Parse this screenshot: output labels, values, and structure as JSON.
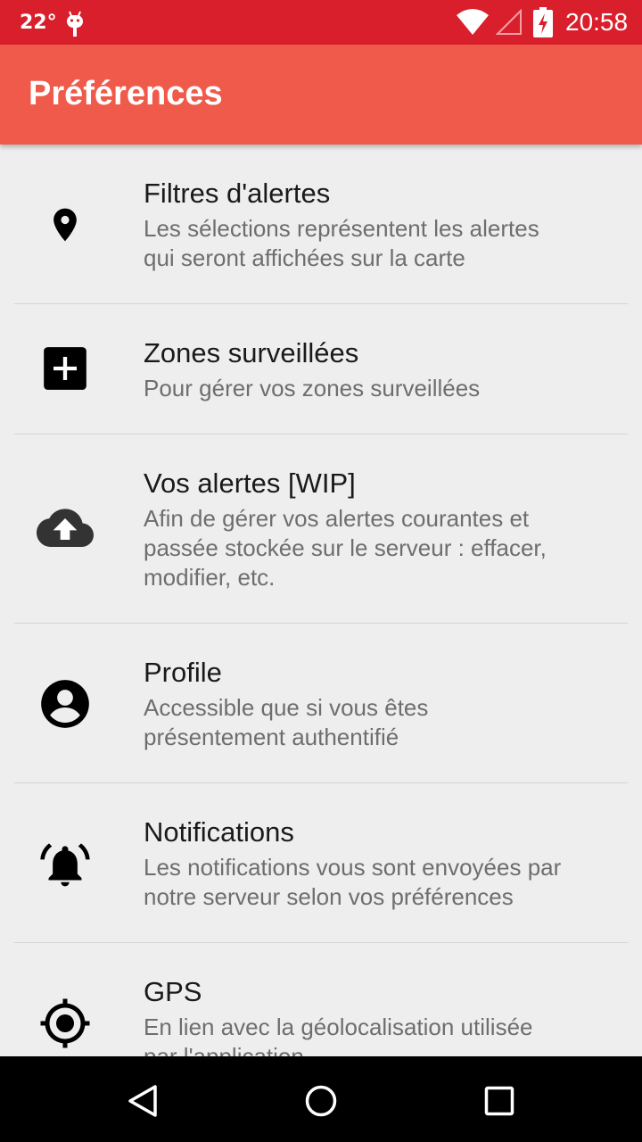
{
  "status_bar": {
    "temperature": "22°",
    "time": "20:58",
    "icons": [
      "android-debug-icon",
      "wifi-icon",
      "signal-icon",
      "battery-charging-icon"
    ]
  },
  "app_bar": {
    "title": "Préférences",
    "color": "#ef5a4a",
    "status_color": "#d81f2b"
  },
  "preferences": [
    {
      "icon": "location-pin-icon",
      "title": "Filtres d'alertes",
      "summary_lines": [
        "Les sélections représentent les alertes",
        "qui seront affichées sur la carte"
      ]
    },
    {
      "icon": "add-box-icon",
      "title": "Zones surveillées",
      "summary_lines": [
        "Pour gérer vos zones surveillées"
      ]
    },
    {
      "icon": "cloud-upload-icon",
      "title": "Vos alertes [WIP]",
      "summary_lines": [
        "Afin de gérer vos alertes courantes et",
        "passée stockée sur le serveur : effacer,",
        "modifier, etc."
      ]
    },
    {
      "icon": "account-circle-icon",
      "title": "Profile",
      "summary_lines": [
        "Accessible que si vous êtes",
        "présentement authentifié"
      ]
    },
    {
      "icon": "notification-bell-icon",
      "title": "Notifications",
      "summary_lines": [
        "Les notifications vous sont envoyées par",
        "notre serveur selon vos préférences"
      ]
    },
    {
      "icon": "gps-fixed-icon",
      "title": "GPS",
      "summary_lines": [
        "En lien avec la géolocalisation utilisée",
        "par l'application"
      ]
    }
  ],
  "nav_bar": {
    "buttons": [
      "back-icon",
      "home-icon",
      "recents-icon"
    ]
  }
}
